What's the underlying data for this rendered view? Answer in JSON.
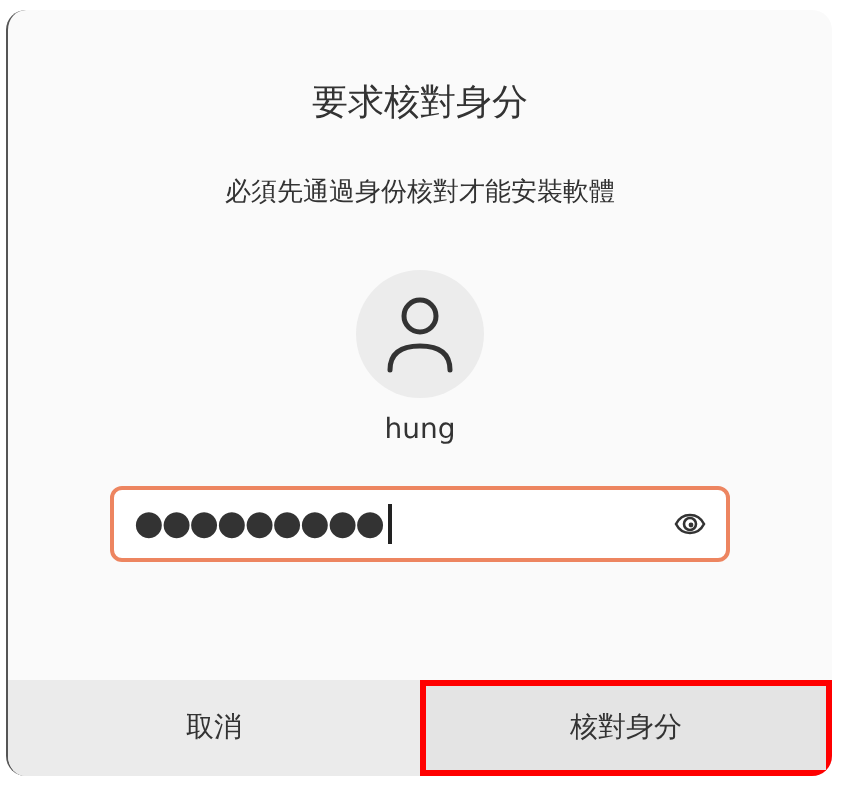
{
  "dialog": {
    "title": "要求核對身分",
    "message": "必須先通過身份核對才能安裝軟體",
    "user": {
      "name": "hung"
    },
    "password": {
      "value": "●●●●●●●●●",
      "focused": true
    },
    "buttons": [
      {
        "label": "取消",
        "highlighted": false
      },
      {
        "label": "核對身分",
        "highlighted": true
      }
    ]
  }
}
